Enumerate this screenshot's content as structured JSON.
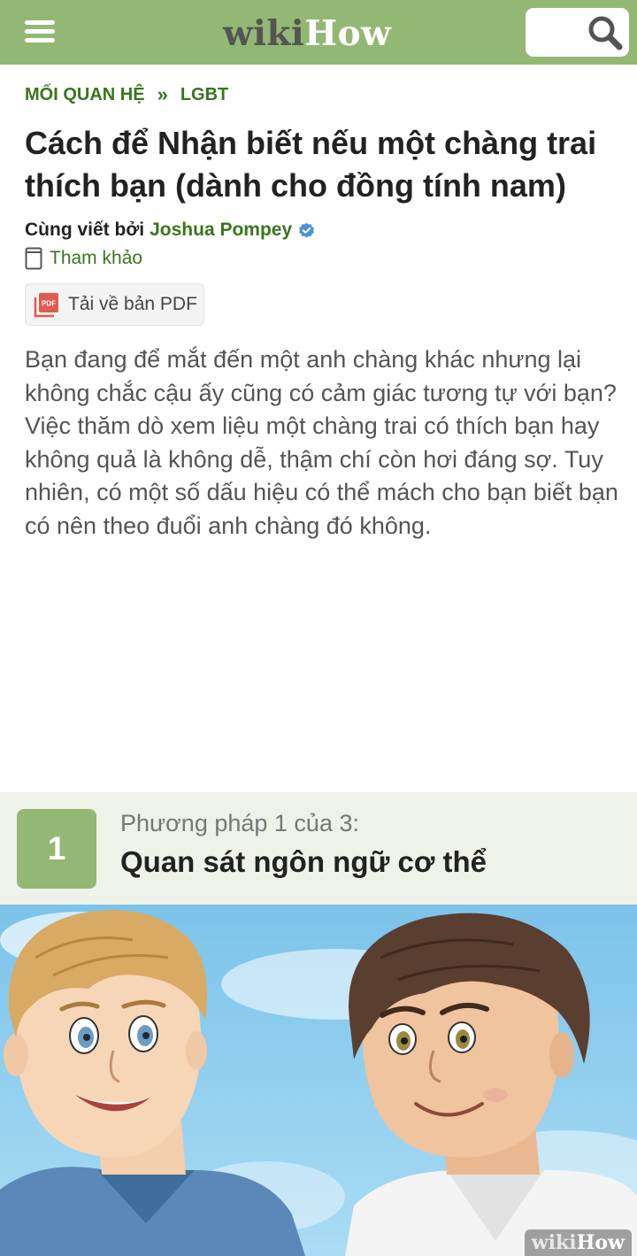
{
  "header": {
    "logo_wiki": "wiki",
    "logo_how": "How"
  },
  "breadcrumb": {
    "items": [
      "MỐI QUAN HỆ",
      "LGBT"
    ],
    "separator": "»"
  },
  "article": {
    "title": "Cách để Nhận biết nếu một chàng trai thích bạn (dành cho đồng tính nam)",
    "coauthored_label": "Cùng viết bởi",
    "author_name": "Joshua Pompey",
    "references_label": "Tham khảo",
    "pdf_label": "Tải về bản PDF",
    "intro": "Bạn đang để mắt đến một anh chàng khác nhưng lại không chắc cậu ấy cũng có cảm giác tương tự với bạn? Việc thăm dò xem liệu một chàng trai có thích bạn hay không quả là không dễ, thậm chí còn hơi đáng sợ. Tuy nhiên, có một số dấu hiệu có thể mách cho bạn biết bạn có nên theo đuổi anh chàng đó không."
  },
  "method": {
    "number": "1",
    "subtitle": "Phương pháp 1 của 3:",
    "title": "Quan sát ngôn ngữ cơ thể"
  },
  "image": {
    "watermark_wiki": "wiki",
    "watermark_how": "How"
  },
  "colors": {
    "brand_green": "#93b874",
    "link_green": "#38761d",
    "method_bg": "#eef2e8",
    "verified_blue": "#4a90d9",
    "pdf_red": "#e05a4f"
  },
  "icons": [
    "hamburger-menu-icon",
    "search-icon",
    "verified-check-icon",
    "book-icon",
    "pdf-icon"
  ]
}
